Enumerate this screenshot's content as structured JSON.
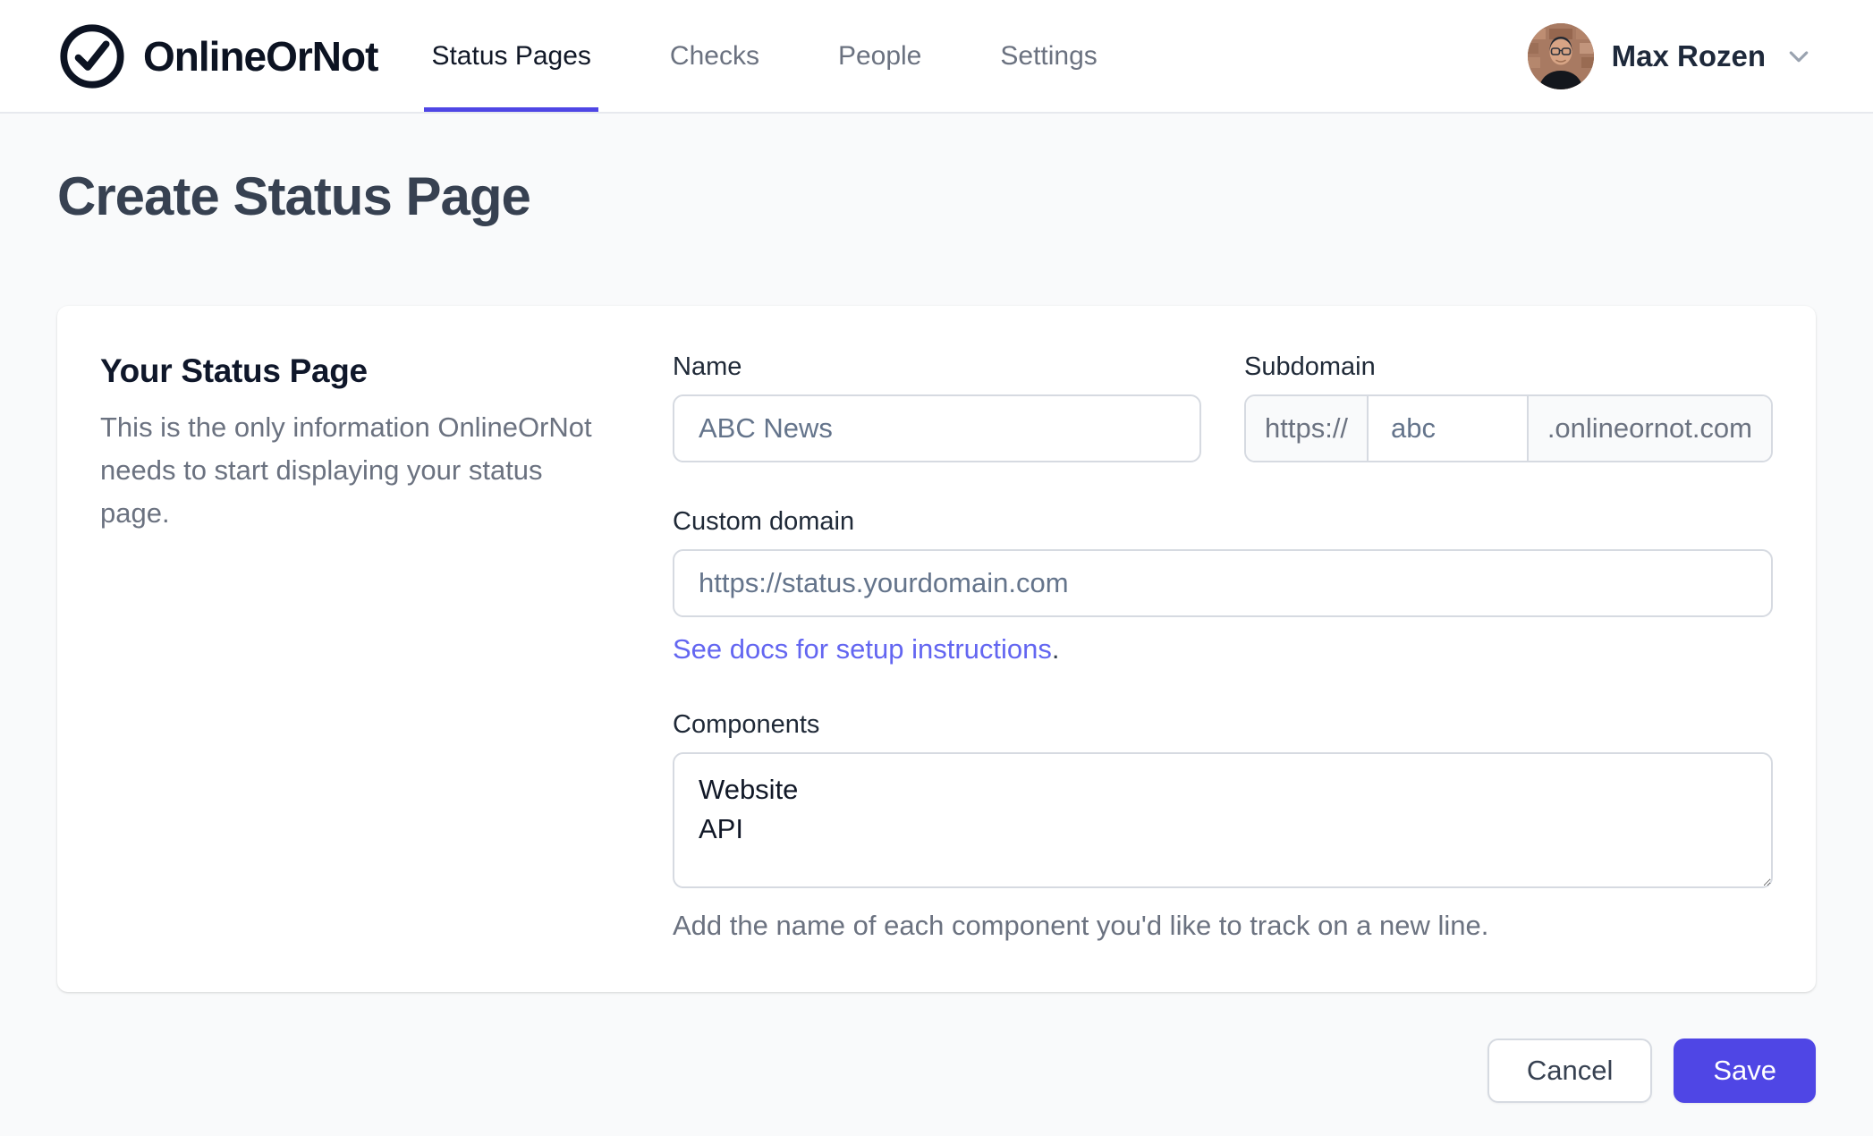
{
  "nav": {
    "brand": "OnlineOrNot",
    "items": [
      {
        "label": "Status Pages",
        "active": true
      },
      {
        "label": "Checks",
        "active": false
      },
      {
        "label": "People",
        "active": false
      },
      {
        "label": "Settings",
        "active": false
      }
    ],
    "user": {
      "name": "Max Rozen"
    }
  },
  "page": {
    "title": "Create Status Page"
  },
  "form": {
    "section": {
      "heading": "Your Status Page",
      "description": "This is the only information OnlineOrNot needs to start displaying your status page."
    },
    "name": {
      "label": "Name",
      "value": "ABC News"
    },
    "subdomain": {
      "label": "Subdomain",
      "prefix": "https://",
      "value": "abc",
      "suffix": ".onlineornot.com"
    },
    "custom_domain": {
      "label": "Custom domain",
      "placeholder": "https://status.yourdomain.com",
      "link_text": "See docs for setup instructions",
      "link_suffix": "."
    },
    "components": {
      "label": "Components",
      "value": "Website\nAPI",
      "help": "Add the name of each component you'd like to track on a new line."
    }
  },
  "actions": {
    "cancel": "Cancel",
    "save": "Save"
  },
  "colors": {
    "accent": "#4f46e5",
    "link": "#6366f1"
  }
}
